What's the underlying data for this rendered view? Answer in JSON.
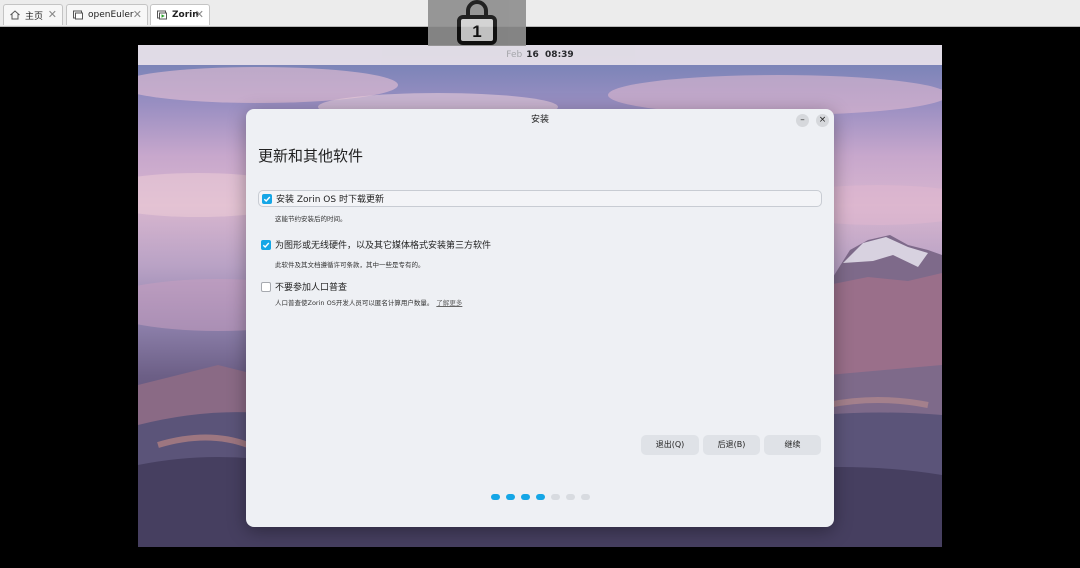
{
  "tabs": [
    {
      "label": "主页",
      "icon": "home-icon",
      "active": false
    },
    {
      "label": "openEuler",
      "icon": "vm-icon",
      "active": false
    },
    {
      "label": "Zorin",
      "icon": "vm-running-icon",
      "active": true
    }
  ],
  "lock": {
    "label": "1"
  },
  "vm_topbar": {
    "month": "Feb",
    "day": "16",
    "time": "08:39"
  },
  "dialog": {
    "title": "安装",
    "heading": "更新和其他软件",
    "options": [
      {
        "label": "安装 Zorin OS 时下载更新",
        "checked": true,
        "description": "这能节约安装后的时间。"
      },
      {
        "label": "为图形或无线硬件，以及其它媒体格式安装第三方软件",
        "checked": true,
        "description": "此软件及其文档遵循许可条款，其中一些是专有的。"
      },
      {
        "label": "不要参加人口普查",
        "checked": false,
        "description": "人口普查使Zorin OS开发人员可以匿名计算用户数量。",
        "link": "了解更多"
      }
    ],
    "buttons": {
      "quit": "退出(Q)",
      "back": "后退(B)",
      "next": "继续"
    },
    "progress": {
      "total": 7,
      "completed": 4
    }
  },
  "colors": {
    "accent": "#15a6e6"
  }
}
